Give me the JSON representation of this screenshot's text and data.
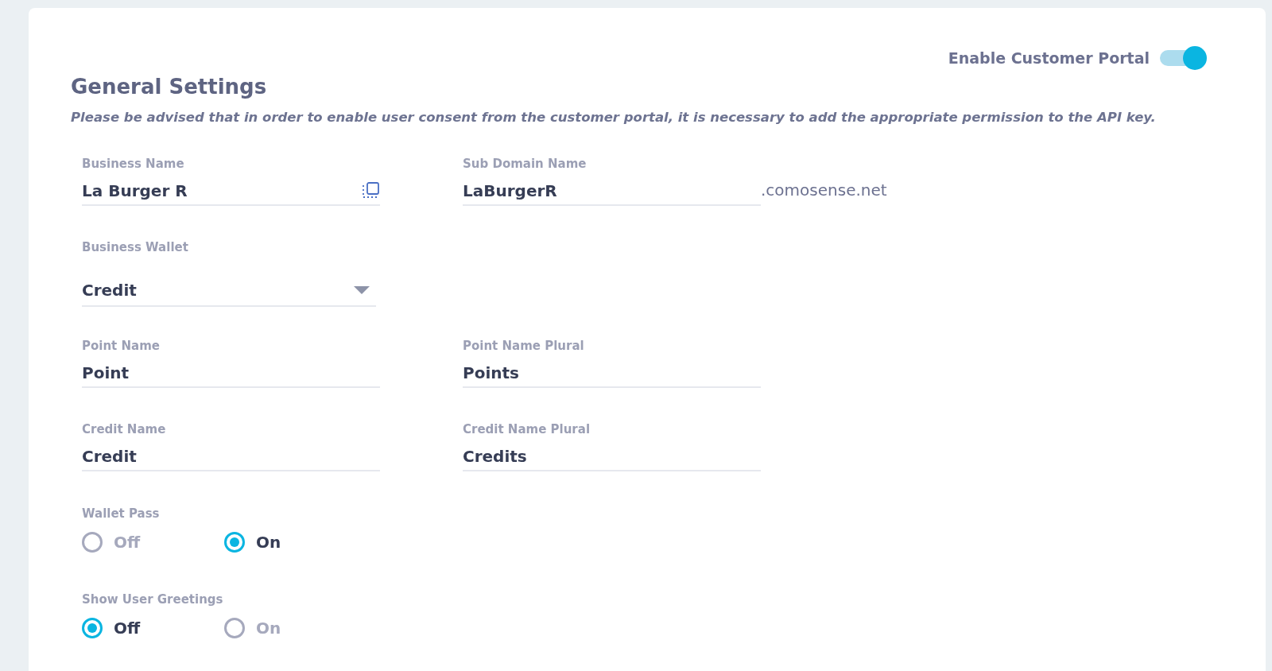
{
  "portal_toggle": {
    "label": "Enable Customer Portal",
    "on": true
  },
  "title": "General Settings",
  "notice": "Please be advised that in order to enable user consent from the customer portal, it is necessary to add the appropriate permission to the API key.",
  "field_rows": [
    [
      {
        "kind": "copyable",
        "label": "Business Name",
        "value": "La Burger R"
      },
      {
        "kind": "domain",
        "label": "Sub Domain Name",
        "value": "LaBurgerR",
        "suffix": ".comosense.net"
      }
    ],
    [
      {
        "kind": "select",
        "label": "Business Wallet",
        "value": "Credit"
      }
    ],
    [
      {
        "kind": "text",
        "label": "Point Name",
        "value": "Point"
      },
      {
        "kind": "text",
        "label": "Point Name Plural",
        "value": "Points"
      }
    ],
    [
      {
        "kind": "text",
        "label": "Credit Name",
        "value": "Credit"
      },
      {
        "kind": "text",
        "label": "Credit Name Plural",
        "value": "Credits"
      }
    ]
  ],
  "radio_groups": [
    {
      "label": "Wallet Pass",
      "options": [
        {
          "label": "Off",
          "selected": false
        },
        {
          "label": "On",
          "selected": true
        }
      ]
    },
    {
      "label": "Show User Greetings",
      "options": [
        {
          "label": "Off",
          "selected": true
        },
        {
          "label": "On",
          "selected": false
        }
      ]
    }
  ]
}
